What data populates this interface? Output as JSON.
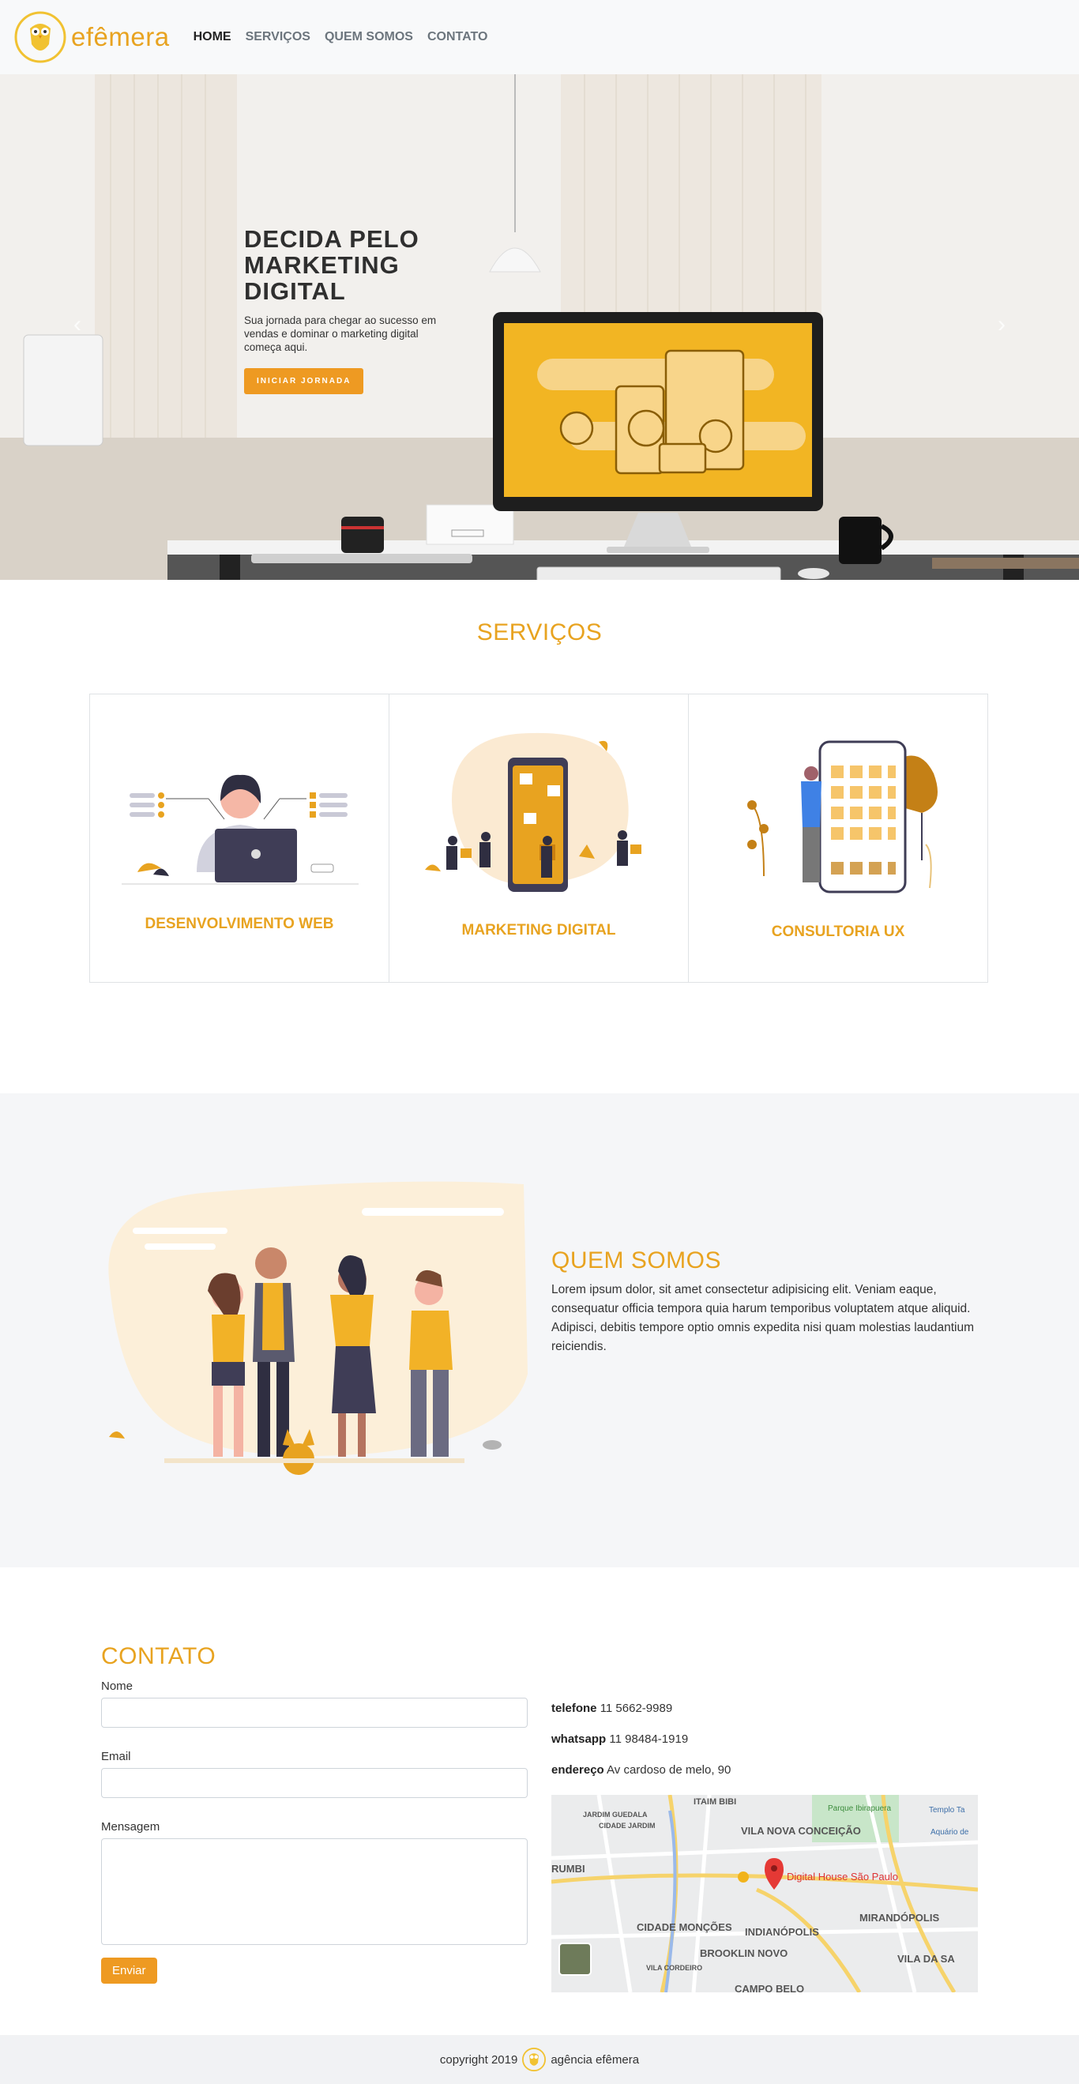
{
  "nav": {
    "brand": "efêmera",
    "links": [
      "HOME",
      "SERVIÇOS",
      "QUEM SOMOS",
      "CONTATO"
    ]
  },
  "hero": {
    "title": "DECIDA PELO MARKETING DIGITAL",
    "text": "Sua jornada para chegar ao sucesso em vendas e dominar o marketing digital começa aqui.",
    "button": "INICIAR JORNADA",
    "prev_icon": "chevron-left-icon",
    "next_icon": "chevron-right-icon"
  },
  "services": {
    "title": "SERVIÇOS",
    "cards": [
      {
        "title": "DESENVOLVIMENTO WEB"
      },
      {
        "title": "MARKETING DIGITAL"
      },
      {
        "title": "CONSULTORIA UX"
      }
    ]
  },
  "about": {
    "title": "QUEM SOMOS",
    "text": "Lorem ipsum dolor, sit amet consectetur adipisicing elit. Veniam eaque, consequatur officia tempora quia harum temporibus voluptatem atque aliquid. Adipisci, debitis tempore optio omnis expedita nisi quam molestias laudantium reiciendis."
  },
  "contact": {
    "title": "CONTATO",
    "name_label": "Nome",
    "email_label": "Email",
    "message_label": "Mensagem",
    "send_button": "Enviar",
    "phone_label": "telefone",
    "phone": "11 5662-9989",
    "whatsapp_label": "whatsapp",
    "whatsapp": "11 98484-1919",
    "address_label": "endereço",
    "address": "Av cardoso de melo, 90",
    "map": {
      "places": [
        "ITAIM BIBI",
        "JARDIM GUEDALA",
        "CIDADE JARDIM",
        "VILA NOVA CONCEIÇÃO",
        "Parque Ibirapuera",
        "Templo Ta",
        "Aquário de",
        "RUMBI",
        "CIDADE MONÇÕES",
        "INDIANÓPOLIS",
        "MIRANDÓPOLIS",
        "BROOKLIN NOVO",
        "VILA CORDEIRO",
        "VILA DA SA",
        "CAMPO BELO"
      ],
      "marker_label": "Digital House São Paulo"
    }
  },
  "footer": {
    "copyright": "copyright 2019",
    "agency": "agência efêmera"
  },
  "colors": {
    "accent": "#e8a320",
    "button": "#ee9a22"
  }
}
